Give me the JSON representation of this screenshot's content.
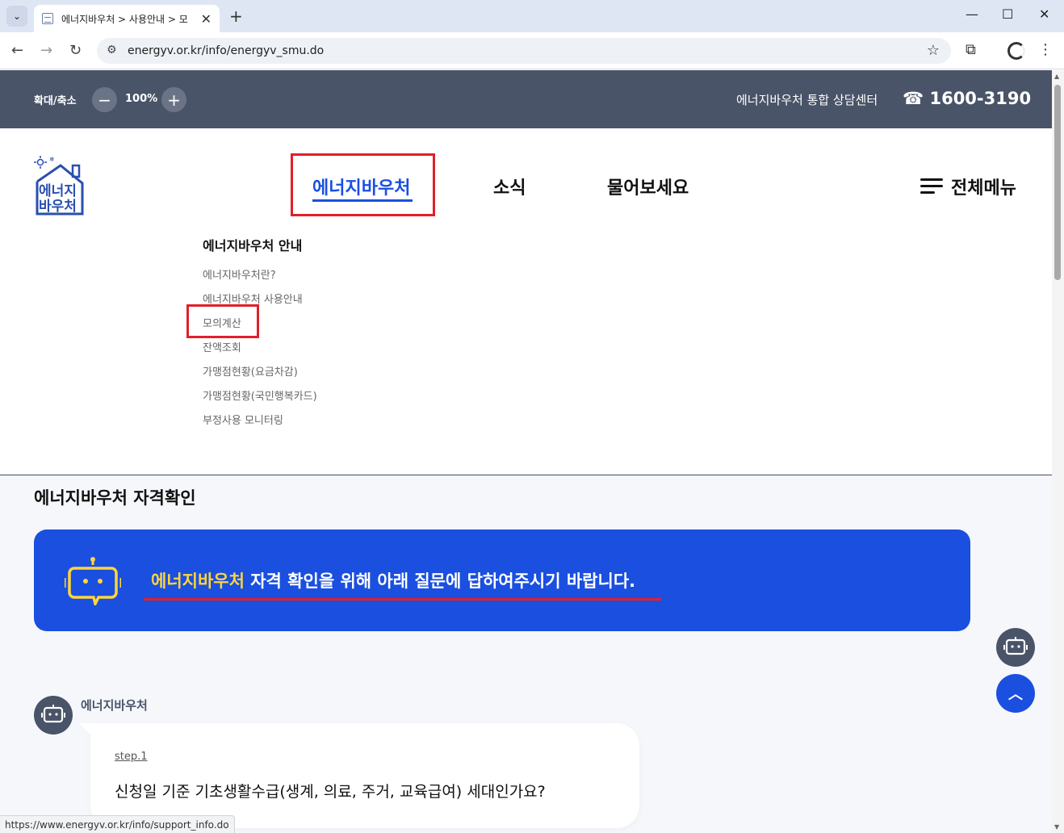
{
  "browser": {
    "tab_title": "에너지바우처 > 사용안내 > 모",
    "new_tab_glyph": "+",
    "url": "energyv.or.kr/info/energyv_smu.do",
    "status_url": "https://www.energyv.or.kr/info/support_info.do"
  },
  "utility": {
    "zoom_label": "확대/축소",
    "zoom_minus": "−",
    "zoom_value": "100%",
    "zoom_plus": "+",
    "center_label": "에너지바우처 통합 상담센터",
    "phone": "☎ 1600-3190"
  },
  "logo": {
    "line1": "에너지",
    "line2": "바우처"
  },
  "gnb": {
    "items": [
      "에너지바우처",
      "소식",
      "물어보세요"
    ],
    "all_menu": "전체메뉴"
  },
  "submenu": {
    "title": "에너지바우처 안내",
    "items": [
      "에너지바우처란?",
      "에너지바우처 사용안내",
      "모의계산",
      "잔액조회",
      "가맹점현황(요금차감)",
      "가맹점현황(국민행복카드)",
      "부정사용 모니터링"
    ]
  },
  "content": {
    "section_title": "에너지바우처 자격확인",
    "banner_highlight": "에너지바우처",
    "banner_text": " 자격 확인을 위해 아래 질문에 답하여주시기 바랍니다.",
    "chat_name": "에너지바우처",
    "step": "step.1",
    "question": "신청일 기준 기초생활수급(생계, 의료, 주거, 교육급여) 세대인가요?"
  },
  "colors": {
    "primary": "#1a4fe0",
    "dark": "#4a5468",
    "highlight": "#ffd53a",
    "annotation": "#e0202a"
  }
}
